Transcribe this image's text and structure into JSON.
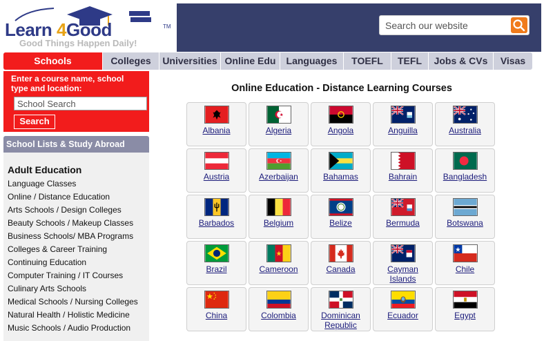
{
  "header": {
    "logo_word_a": "Learn ",
    "logo_word_b": "4",
    "logo_word_c": "Good",
    "logo_tm": "TM",
    "tagline": "Good Things Happen Daily!",
    "search_placeholder": "Search our website",
    "search_icon": "search-icon"
  },
  "nav": {
    "tabs": [
      {
        "label": "Schools",
        "active": true
      },
      {
        "label": "Colleges",
        "active": false
      },
      {
        "label": "Universities",
        "active": false
      },
      {
        "label": "Online Edu",
        "active": false
      },
      {
        "label": "Languages",
        "active": false
      },
      {
        "label": "TOEFL",
        "active": false
      },
      {
        "label": "TEFL",
        "active": false
      },
      {
        "label": "Jobs & CVs",
        "active": false
      },
      {
        "label": "Visas",
        "active": false
      }
    ]
  },
  "sidebar": {
    "course_prompt": "Enter a course name, school type and location:",
    "school_search_placeholder": "School Search",
    "search_button": "Search",
    "section_heading": "School Lists & Study Abroad",
    "category": "Adult Education",
    "items": [
      "Language Classes",
      "Online / Distance Education",
      "Arts Schools / Design Colleges",
      "Beauty Schools / Makeup Classes",
      "Business Schools/ MBA Programs",
      "Colleges & Career Training",
      "Continuing Education",
      "Computer Training / IT Courses",
      "Culinary Arts Schools",
      "Medical Schools / Nursing Colleges",
      "Natural Health / Holistic Medicine",
      "Music Schools / Audio Production"
    ]
  },
  "main": {
    "title": "Online Education - Distance Learning Courses",
    "countries": [
      {
        "name": "Albania",
        "flag": "albania-flag-icon"
      },
      {
        "name": "Algeria",
        "flag": "algeria-flag-icon"
      },
      {
        "name": "Angola",
        "flag": "angola-flag-icon"
      },
      {
        "name": "Anguilla",
        "flag": "anguilla-flag-icon"
      },
      {
        "name": "Australia",
        "flag": "australia-flag-icon"
      },
      {
        "name": "Austria",
        "flag": "austria-flag-icon"
      },
      {
        "name": "Azerbaijan",
        "flag": "azerbaijan-flag-icon"
      },
      {
        "name": "Bahamas",
        "flag": "bahamas-flag-icon"
      },
      {
        "name": "Bahrain",
        "flag": "bahrain-flag-icon"
      },
      {
        "name": "Bangladesh",
        "flag": "bangladesh-flag-icon"
      },
      {
        "name": "Barbados",
        "flag": "barbados-flag-icon"
      },
      {
        "name": "Belgium",
        "flag": "belgium-flag-icon"
      },
      {
        "name": "Belize",
        "flag": "belize-flag-icon"
      },
      {
        "name": "Bermuda",
        "flag": "bermuda-flag-icon"
      },
      {
        "name": "Botswana",
        "flag": "botswana-flag-icon"
      },
      {
        "name": "Brazil",
        "flag": "brazil-flag-icon"
      },
      {
        "name": "Cameroon",
        "flag": "cameroon-flag-icon"
      },
      {
        "name": "Canada",
        "flag": "canada-flag-icon"
      },
      {
        "name": "Cayman Islands",
        "flag": "cayman-islands-flag-icon"
      },
      {
        "name": "Chile",
        "flag": "chile-flag-icon"
      },
      {
        "name": "China",
        "flag": "china-flag-icon"
      },
      {
        "name": "Colombia",
        "flag": "colombia-flag-icon"
      },
      {
        "name": "Dominican Republic",
        "flag": "dominican-republic-flag-icon"
      },
      {
        "name": "Ecuador",
        "flag": "ecuador-flag-icon"
      },
      {
        "name": "Egypt",
        "flag": "egypt-flag-icon"
      }
    ]
  },
  "colors": {
    "brand_navy": "#2e3a87",
    "header_band": "#363f6b",
    "accent_red": "#f21c1c",
    "search_orange": "#f07b1b",
    "nav_gray": "#ced0dc",
    "link_blue": "#1a1a7a"
  }
}
